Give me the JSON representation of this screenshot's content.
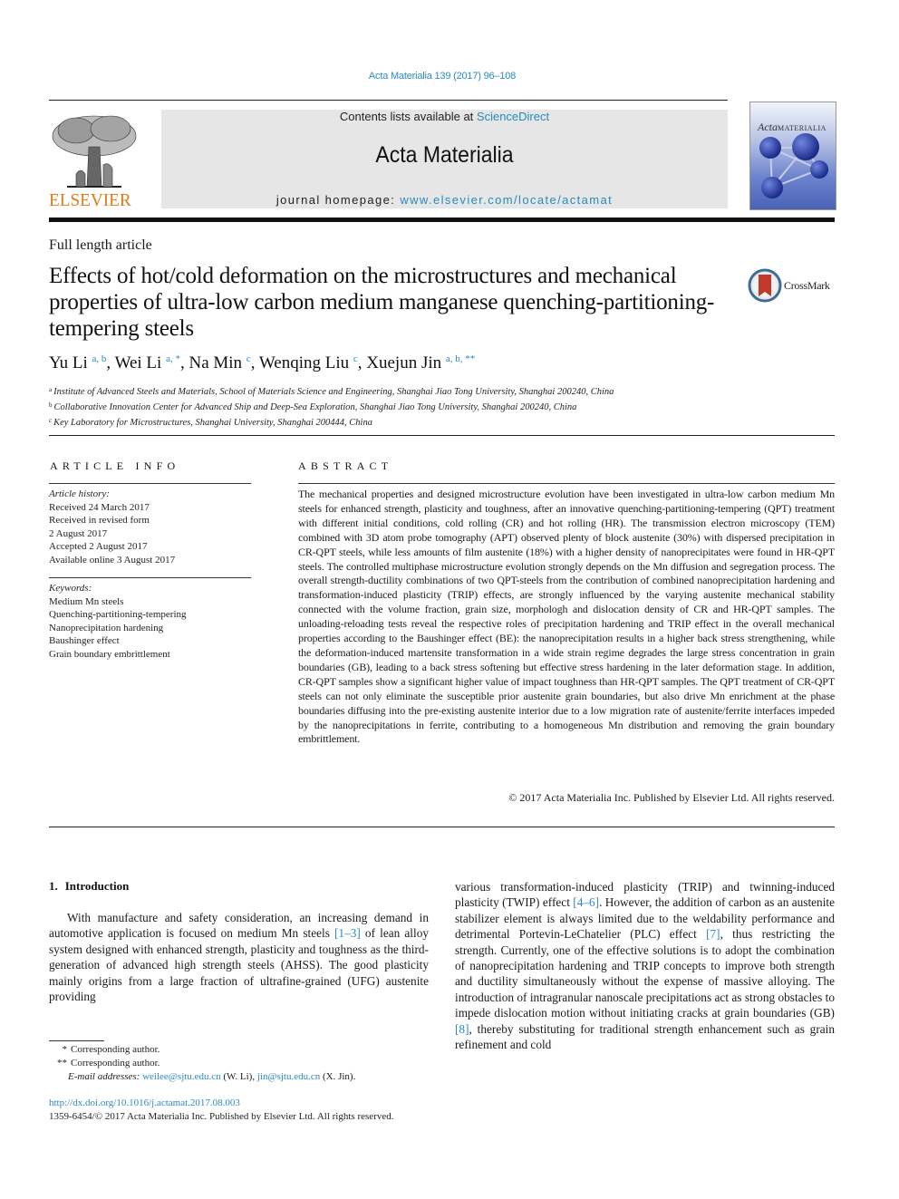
{
  "header": {
    "citation": "Acta Materialia 139 (2017) 96–108",
    "publisher_logo": "ELSEVIER",
    "contents_prefix": "Contents lists available at ",
    "contents_link": "ScienceDirect",
    "journal_title": "Acta Materialia",
    "homepage_prefix": "journal homepage: ",
    "homepage_link": "www.elsevier.com/locate/actamat",
    "cover": {
      "title_italic": "Acta",
      "title_caps": "MATERIALIA",
      "icon": "journal-cover-image"
    },
    "colors": {
      "link": "#2a8ac0",
      "elsevier_orange": "#e07a1a",
      "banner_bg": "#e6e6e6"
    }
  },
  "article": {
    "type": "Full length article",
    "title": "Effects of hot/cold deformation on the microstructures and mechanical properties of ultra-low carbon medium manganese quenching-partitioning-tempering steels",
    "crossmark_label": "CrossMark",
    "authors": [
      {
        "name": "Yu Li",
        "sup": "a, b"
      },
      {
        "name": "Wei Li",
        "sup": "a, *"
      },
      {
        "name": "Na Min",
        "sup": "c"
      },
      {
        "name": "Wenqing Liu",
        "sup": "c"
      },
      {
        "name": "Xuejun Jin",
        "sup": "a, b, **"
      }
    ],
    "affiliations": [
      {
        "key": "a",
        "text": "Institute of Advanced Steels and Materials, School of Materials Science and Engineering, Shanghai Jiao Tong University, Shanghai 200240, China"
      },
      {
        "key": "b",
        "text": "Collaborative Innovation Center for Advanced Ship and Deep-Sea Exploration, Shanghai Jiao Tong University, Shanghai 200240, China"
      },
      {
        "key": "c",
        "text": "Key Laboratory for Microstructures, Shanghai University, Shanghai 200444, China"
      }
    ]
  },
  "article_info": {
    "heading": "ARTICLE INFO",
    "history_label": "Article history:",
    "history": [
      "Received 24 March 2017",
      "Received in revised form",
      "2 August 2017",
      "Accepted 2 August 2017",
      "Available online 3 August 2017"
    ],
    "keywords_label": "Keywords:",
    "keywords": [
      "Medium Mn steels",
      "Quenching-partitioning-tempering",
      "Nanoprecipitation hardening",
      "Baushinger effect",
      "Grain boundary embrittlement"
    ]
  },
  "abstract": {
    "heading": "ABSTRACT",
    "text": "The mechanical properties and designed microstructure evolution have been investigated in ultra-low carbon medium Mn steels for enhanced strength, plasticity and toughness, after an innovative quenching-partitioning-tempering (QPT) treatment with different initial conditions, cold rolling (CR) and hot rolling (HR). The transmission electron microscopy (TEM) combined with 3D atom probe tomography (APT) observed plenty of block austenite (30%) with dispersed precipitation in CR-QPT steels, while less amounts of film austenite (18%) with a higher density of nanoprecipitates were found in HR-QPT steels. The controlled multiphase microstructure evolution strongly depends on the Mn diffusion and segregation process. The overall strength-ductility combinations of two QPT-steels from the contribution of combined nanoprecipitation hardening and transformation-induced plasticity (TRIP) effects, are strongly influenced by the varying austenite mechanical stability connected with the volume fraction, grain size, morphologh and dislocation density of CR and HR-QPT samples. The unloading-reloading tests reveal the respective roles of precipitation hardening and TRIP effect in the overall mechanical properties according to the Baushinger effect (BE): the nanoprecipitation results in a higher back stress strengthening, while the deformation-induced martensite transformation in a wide strain regime degrades the large stress concentration in grain boundaries (GB), leading to a back stress softening but effective stress hardening in the later deformation stage. In addition, CR-QPT samples show a significant higher value of impact toughness than HR-QPT samples. The QPT treatment of CR-QPT steels can not only eliminate the susceptible prior austenite grain boundaries, but also drive Mn enrichment at the phase boundaries diffusing into the pre-existing austenite interior due to a low migration rate of austenite/ferrite interfaces impeded by the nanoprecipitations in ferrite, contributing to a homogeneous Mn distribution and removing the grain boundary embrittlement.",
    "copyright": "© 2017 Acta Materialia Inc. Published by Elsevier Ltd. All rights reserved."
  },
  "body": {
    "section_number": "1.",
    "section_title": "Introduction",
    "left_col": [
      {
        "t": "With manufacture and safety consideration, an increasing demand in automotive application is focused on medium Mn steels "
      },
      {
        "ref": "[1–3]"
      },
      {
        "t": " of lean alloy system designed with enhanced strength, plasticity and toughness as the third-generation of advanced high strength steels (AHSS). The good plasticity mainly origins from a large fraction of ultrafine-grained (UFG) austenite providing"
      }
    ],
    "right_col": [
      {
        "t": "various transformation-induced plasticity (TRIP) and twinning-induced plasticity (TWIP) effect "
      },
      {
        "ref": "[4–6]"
      },
      {
        "t": ". However, the addition of carbon as an austenite stabilizer element is always limited due to the weldability performance and detrimental Portevin-LeChatelier (PLC) effect "
      },
      {
        "ref": "[7]"
      },
      {
        "t": ", thus restricting the strength. Currently, one of the effective solutions is to adopt the combination of nanoprecipitation hardening and TRIP concepts to improve both strength and ductility simultaneously without the expense of massive alloying. The introduction of intragranular nanoscale precipitations act as strong obstacles to impede dislocation motion without initiating cracks at grain boundaries (GB) "
      },
      {
        "ref": "[8]"
      },
      {
        "t": ", thereby substituting for traditional strength enhancement such as grain refinement and cold"
      }
    ]
  },
  "footnotes": {
    "corr1_mark": "*",
    "corr1_text": "Corresponding author.",
    "corr2_mark": "**",
    "corr2_text": "Corresponding author.",
    "email_label": "E-mail addresses:",
    "email1": "weilee@sjtu.edu.cn",
    "email1_owner": " (W. Li), ",
    "email2": "jin@sjtu.edu.cn",
    "email2_owner": " (X. Jin).",
    "doi": "http://dx.doi.org/10.1016/j.actamat.2017.08.003",
    "issn": "1359-6454/© 2017 Acta Materialia Inc. Published by Elsevier Ltd. All rights reserved."
  }
}
